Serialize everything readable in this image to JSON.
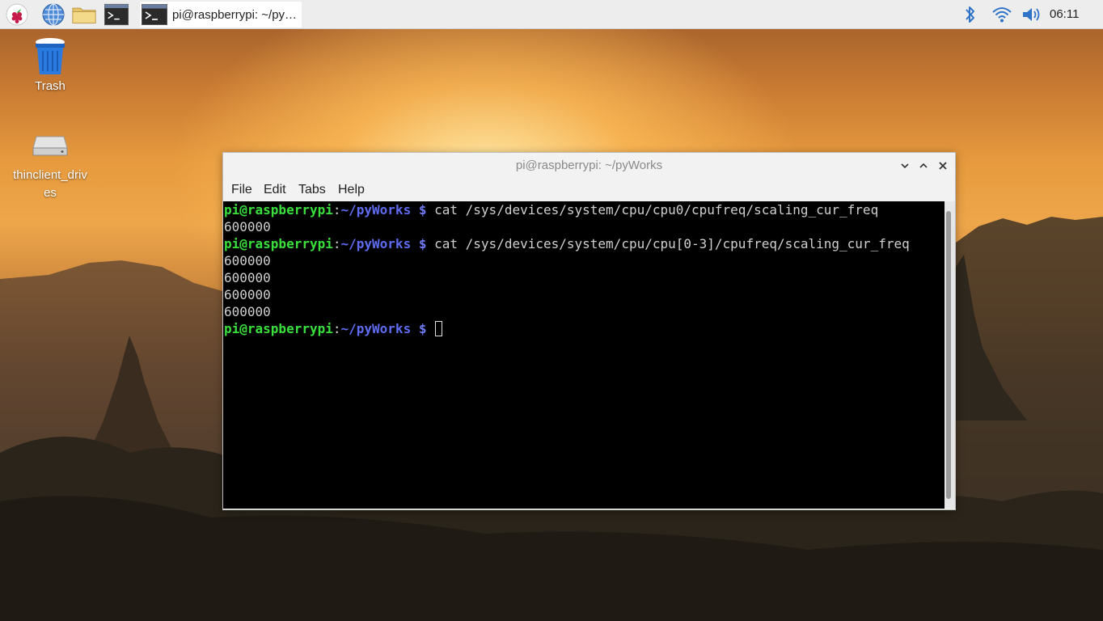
{
  "taskbar": {
    "launchers": [
      {
        "icon": "raspberry-menu-icon"
      },
      {
        "icon": "web-browser-icon"
      },
      {
        "icon": "file-manager-icon"
      },
      {
        "icon": "terminal-icon"
      }
    ],
    "active_task": {
      "icon": "terminal-icon",
      "title": "pi@raspberrypi: ~/py…"
    },
    "tray": {
      "bluetooth_icon": "bluetooth-icon",
      "wifi_icon": "wifi-icon",
      "volume_icon": "volume-icon"
    },
    "clock": "06:11"
  },
  "desktop": {
    "icons": [
      {
        "label": "Trash",
        "icon": "trash-icon"
      },
      {
        "label_line1": "thinclient_driv",
        "label_line2": "es",
        "icon": "drive-icon"
      }
    ]
  },
  "window": {
    "title": "pi@raspberrypi: ~/pyWorks",
    "menu": [
      "File",
      "Edit",
      "Tabs",
      "Help"
    ],
    "prompt": {
      "user_host": "pi@raspberrypi",
      "sep": ":",
      "path": "~/pyWorks",
      "dollar": "$"
    },
    "lines": [
      {
        "type": "cmd",
        "command": "cat /sys/devices/system/cpu/cpu0/cpufreq/scaling_cur_freq"
      },
      {
        "type": "out",
        "text": "600000"
      },
      {
        "type": "cmd",
        "command": "cat /sys/devices/system/cpu/cpu[0-3]/cpufreq/scaling_cur_freq"
      },
      {
        "type": "out",
        "text": "600000"
      },
      {
        "type": "out",
        "text": "600000"
      },
      {
        "type": "out",
        "text": "600000"
      },
      {
        "type": "out",
        "text": "600000"
      },
      {
        "type": "cmd",
        "command": ""
      }
    ]
  },
  "colors": {
    "prompt_user": "#39e03c",
    "prompt_path": "#5f6cf2",
    "terminal_bg": "#000000",
    "terminal_fg": "#d0d0d0",
    "panel_bg": "#ededed"
  }
}
